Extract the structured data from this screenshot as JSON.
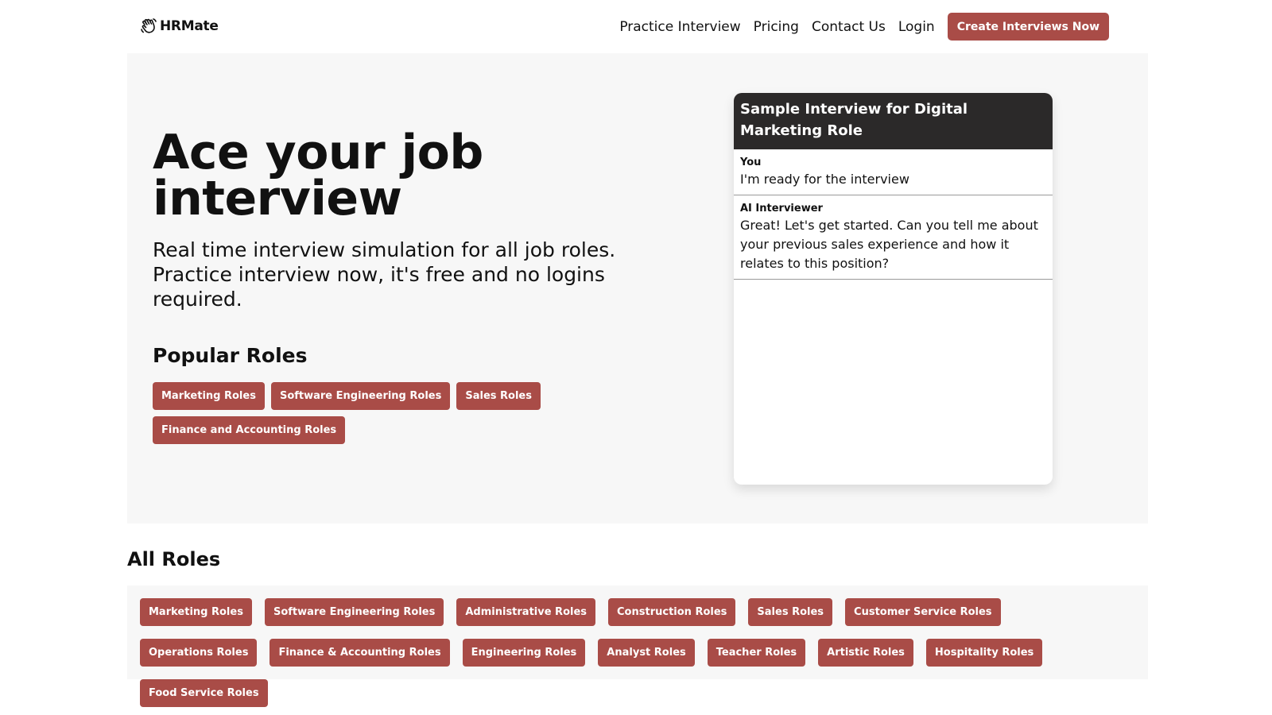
{
  "header": {
    "logo_text": "HRMate",
    "nav": [
      "Practice Interview",
      "Pricing",
      "Contact Us",
      "Login"
    ],
    "cta_label": "Create Interviews Now"
  },
  "hero": {
    "title": "Ace your job interview",
    "subtitle": "Real time interview simulation for all job roles. Practice interview now, it's free and no logins required.",
    "popular_title": "Popular Roles",
    "popular_roles": [
      "Marketing Roles",
      "Software Engineering Roles",
      "Sales Roles",
      "Finance and Accounting Roles"
    ]
  },
  "chat": {
    "title": "Sample Interview for Digital Marketing Role",
    "messages": [
      {
        "sender": "You",
        "text": "I'm ready for the interview"
      },
      {
        "sender": "AI Interviewer",
        "text": "Great! Let's get started. Can you tell me about your previous sales experience and how it relates to this position?"
      }
    ]
  },
  "all_roles": {
    "title": "All Roles",
    "roles": [
      "Marketing Roles",
      "Software Engineering Roles",
      "Administrative Roles",
      "Construction Roles",
      "Sales Roles",
      "Customer Service Roles",
      "Operations Roles",
      "Finance & Accounting Roles",
      "Engineering Roles",
      "Analyst Roles",
      "Teacher Roles",
      "Artistic Roles",
      "Hospitality Roles",
      "Food Service Roles"
    ]
  },
  "colors": {
    "accent": "#a94c47",
    "chat_header": "#2b2929",
    "section_bg": "#f7f7f7"
  },
  "icons": {
    "logo": "hand-wave-icon"
  }
}
